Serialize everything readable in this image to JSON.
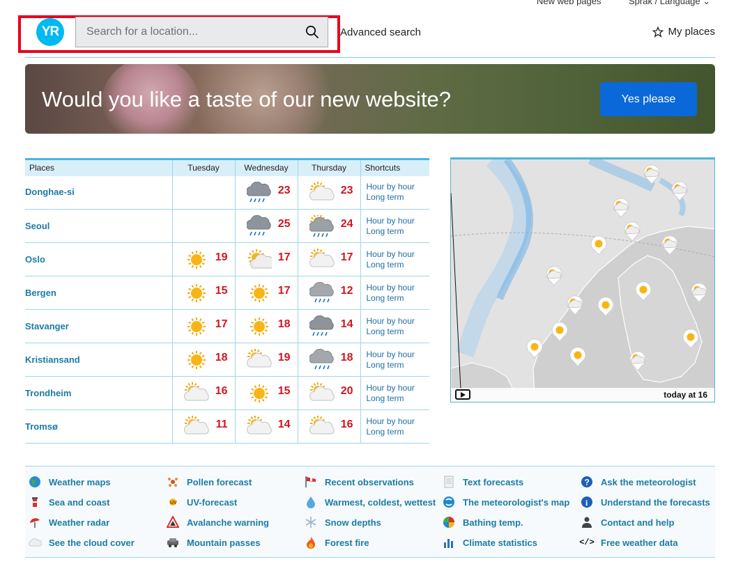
{
  "top_links": {
    "new_pages": "New web pages",
    "language": "Språk / Language"
  },
  "header": {
    "logo": "YR",
    "search_placeholder": "Search for a location...",
    "advanced_search": "Advanced search",
    "my_places": "My places"
  },
  "banner": {
    "title": "Would you like a taste of our new website?",
    "button": "Yes please"
  },
  "table": {
    "headers": [
      "Places",
      "Tuesday",
      "Wednesday",
      "Thursday",
      "Shortcuts"
    ],
    "shortcut_labels": [
      "Hour by hour",
      "Long term"
    ],
    "rows": [
      {
        "place": "Donghae-si",
        "days": [
          {
            "icon": "",
            "temp": ""
          },
          {
            "icon": "rain-cloud-icon",
            "temp": "23"
          },
          {
            "icon": "partly-sunny-icon",
            "temp": "23"
          }
        ]
      },
      {
        "place": "Seoul",
        "days": [
          {
            "icon": "",
            "temp": ""
          },
          {
            "icon": "rain-cloud-icon",
            "temp": "25"
          },
          {
            "icon": "sun-rain-cloud-icon",
            "temp": "24"
          }
        ]
      },
      {
        "place": "Oslo",
        "days": [
          {
            "icon": "sun-icon",
            "temp": "19"
          },
          {
            "icon": "sun-cloud-icon",
            "temp": "17"
          },
          {
            "icon": "partly-sunny-icon",
            "temp": "17"
          }
        ]
      },
      {
        "place": "Bergen",
        "days": [
          {
            "icon": "sun-icon",
            "temp": "15"
          },
          {
            "icon": "sun-icon",
            "temp": "17"
          },
          {
            "icon": "light-rain-icon",
            "temp": "12"
          }
        ]
      },
      {
        "place": "Stavanger",
        "days": [
          {
            "icon": "sun-icon",
            "temp": "17"
          },
          {
            "icon": "sun-icon",
            "temp": "18"
          },
          {
            "icon": "rain-cloud-icon",
            "temp": "14"
          }
        ]
      },
      {
        "place": "Kristiansand",
        "days": [
          {
            "icon": "sun-icon",
            "temp": "18"
          },
          {
            "icon": "partly-sunny-icon",
            "temp": "19"
          },
          {
            "icon": "light-rain-icon",
            "temp": "18"
          }
        ]
      },
      {
        "place": "Trondheim",
        "days": [
          {
            "icon": "partly-sunny-icon",
            "temp": "16"
          },
          {
            "icon": "sun-icon",
            "temp": "15"
          },
          {
            "icon": "partly-sunny-icon",
            "temp": "20"
          }
        ]
      },
      {
        "place": "Tromsø",
        "days": [
          {
            "icon": "partly-sunny-icon",
            "temp": "11"
          },
          {
            "icon": "partly-sunny-icon",
            "temp": "14"
          },
          {
            "icon": "partly-sunny-icon",
            "temp": "16"
          }
        ]
      }
    ]
  },
  "map": {
    "time_label": "today at 16"
  },
  "links": [
    [
      {
        "label": "Weather maps",
        "icon": "globe-icon"
      },
      {
        "label": "Sea and coast",
        "icon": "lighthouse-icon"
      },
      {
        "label": "Weather radar",
        "icon": "radar-icon"
      },
      {
        "label": "See the cloud cover",
        "icon": "cloud-icon"
      }
    ],
    [
      {
        "label": "Pollen forecast",
        "icon": "pollen-icon"
      },
      {
        "label": "UV-forecast",
        "icon": "uv-icon"
      },
      {
        "label": "Avalanche warning",
        "icon": "avalanche-icon"
      },
      {
        "label": "Mountain passes",
        "icon": "car-icon"
      }
    ],
    [
      {
        "label": "Recent observations",
        "icon": "windsock-icon"
      },
      {
        "label": "Warmest, coldest, wettest",
        "icon": "drop-icon"
      },
      {
        "label": "Snow depths",
        "icon": "snowflake-icon"
      },
      {
        "label": "Forest fire",
        "icon": "fire-icon"
      }
    ],
    [
      {
        "label": "Text forecasts",
        "icon": "document-icon"
      },
      {
        "label": "The meteorologist's map",
        "icon": "cyclone-icon"
      },
      {
        "label": "Bathing temp.",
        "icon": "beach-ball-icon"
      },
      {
        "label": "Climate statistics",
        "icon": "bar-chart-icon"
      }
    ],
    [
      {
        "label": "Ask the meteorologist",
        "icon": "question-icon"
      },
      {
        "label": "Understand the forecasts",
        "icon": "info-icon"
      },
      {
        "label": "Contact and help",
        "icon": "person-icon"
      },
      {
        "label": "Free weather data",
        "icon": "code-icon"
      }
    ]
  ]
}
